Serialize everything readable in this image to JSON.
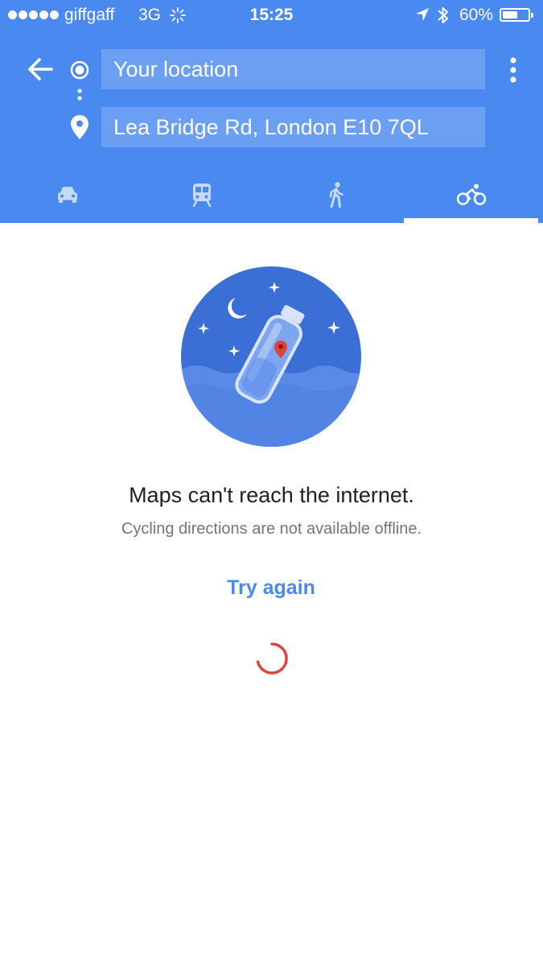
{
  "status_bar": {
    "carrier": "giffgaff",
    "network": "3G",
    "time": "15:25",
    "battery_percent": "60%",
    "battery_level": 0.6
  },
  "directions": {
    "origin": "Your location",
    "destination": "Lea Bridge Rd, London E10 7QL"
  },
  "travel_modes": [
    {
      "name": "driving",
      "icon": "car-icon"
    },
    {
      "name": "transit",
      "icon": "train-icon"
    },
    {
      "name": "walking",
      "icon": "walk-icon"
    },
    {
      "name": "cycling",
      "icon": "bike-icon",
      "selected": true
    }
  ],
  "error": {
    "illustration": "message-in-a-bottle",
    "title": "Maps can't reach the internet.",
    "subtitle": "Cycling directions are not available offline.",
    "retry_label": "Try again"
  },
  "colors": {
    "header": "#4a89f0",
    "field": "#6a9ff3",
    "accent": "#4a89f0",
    "spinner": "#db4437",
    "pin": "#db4437"
  }
}
